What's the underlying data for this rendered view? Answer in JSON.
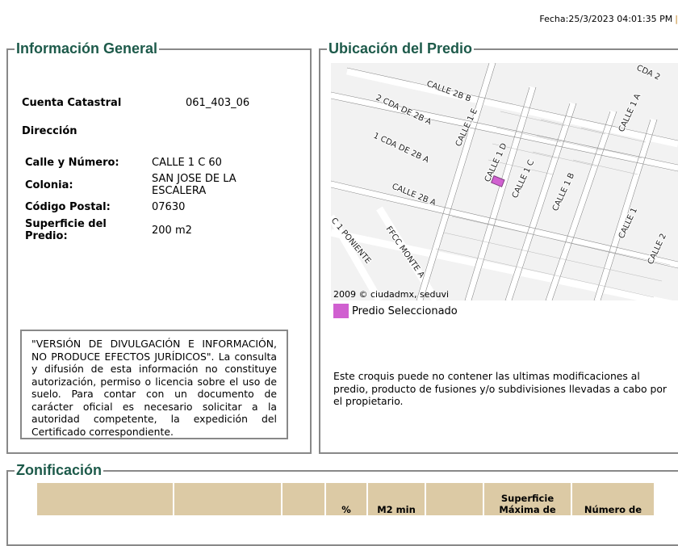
{
  "header": {
    "fecha": "Fecha:25/3/2023 04:01:35 PM"
  },
  "info": {
    "title": "Información General",
    "cuenta_label": "Cuenta Catastral",
    "cuenta_value": "061_403_06",
    "direccion_label": "Dirección",
    "calle_label": "Calle y Número:",
    "calle_value": "CALLE 1 C 60",
    "colonia_label": "Colonia:",
    "colonia_value": "SAN JOSE DE LA ESCALERA",
    "cp_label": "Código Postal:",
    "cp_value": "07630",
    "sup_label": "Superficie del Predio:",
    "sup_value": "200 m2",
    "notice": "\"VERSIÓN DE DIVULGACIÓN E INFORMACIÓN, NO PRODUCE EFECTOS JURÍDICOS\". La consulta y difusión de esta información no constituye autorización, permiso o licencia sobre el uso de suelo. Para contar con un documento de carácter oficial es necesario solicitar a la autoridad competente, la expedición del Certificado correspondiente."
  },
  "ubicacion": {
    "title": "Ubicación del Predio",
    "copyright": "2009 © ciudadmx, seduvi",
    "legend_label": "Predio Seleccionado",
    "legend_color": "#d060d0",
    "disclaimer": "Este croquis puede no contener las ultimas modificaciones al predio, producto de fusiones y/o subdivisiones llevadas a cabo por el propietario.",
    "streets": [
      "CALLE 2B B",
      "2 CDA DE 2B A",
      "1 CDA DE 2B A",
      "CALLE 1 E",
      "CALLE 1 D",
      "CALLE 1 C",
      "CALLE 1 B",
      "CALLE 1 A",
      "CALLE 2B A",
      "CALLE 1",
      "CALLE 2",
      "C 1 PONIENTE",
      "FFCC MONTE A",
      "CDA 2"
    ]
  },
  "zonificacion": {
    "title": "Zonificación",
    "headers": [
      "",
      "",
      "",
      "%",
      "M2 min",
      "",
      "Superficie Máxima de",
      "Número de"
    ]
  }
}
